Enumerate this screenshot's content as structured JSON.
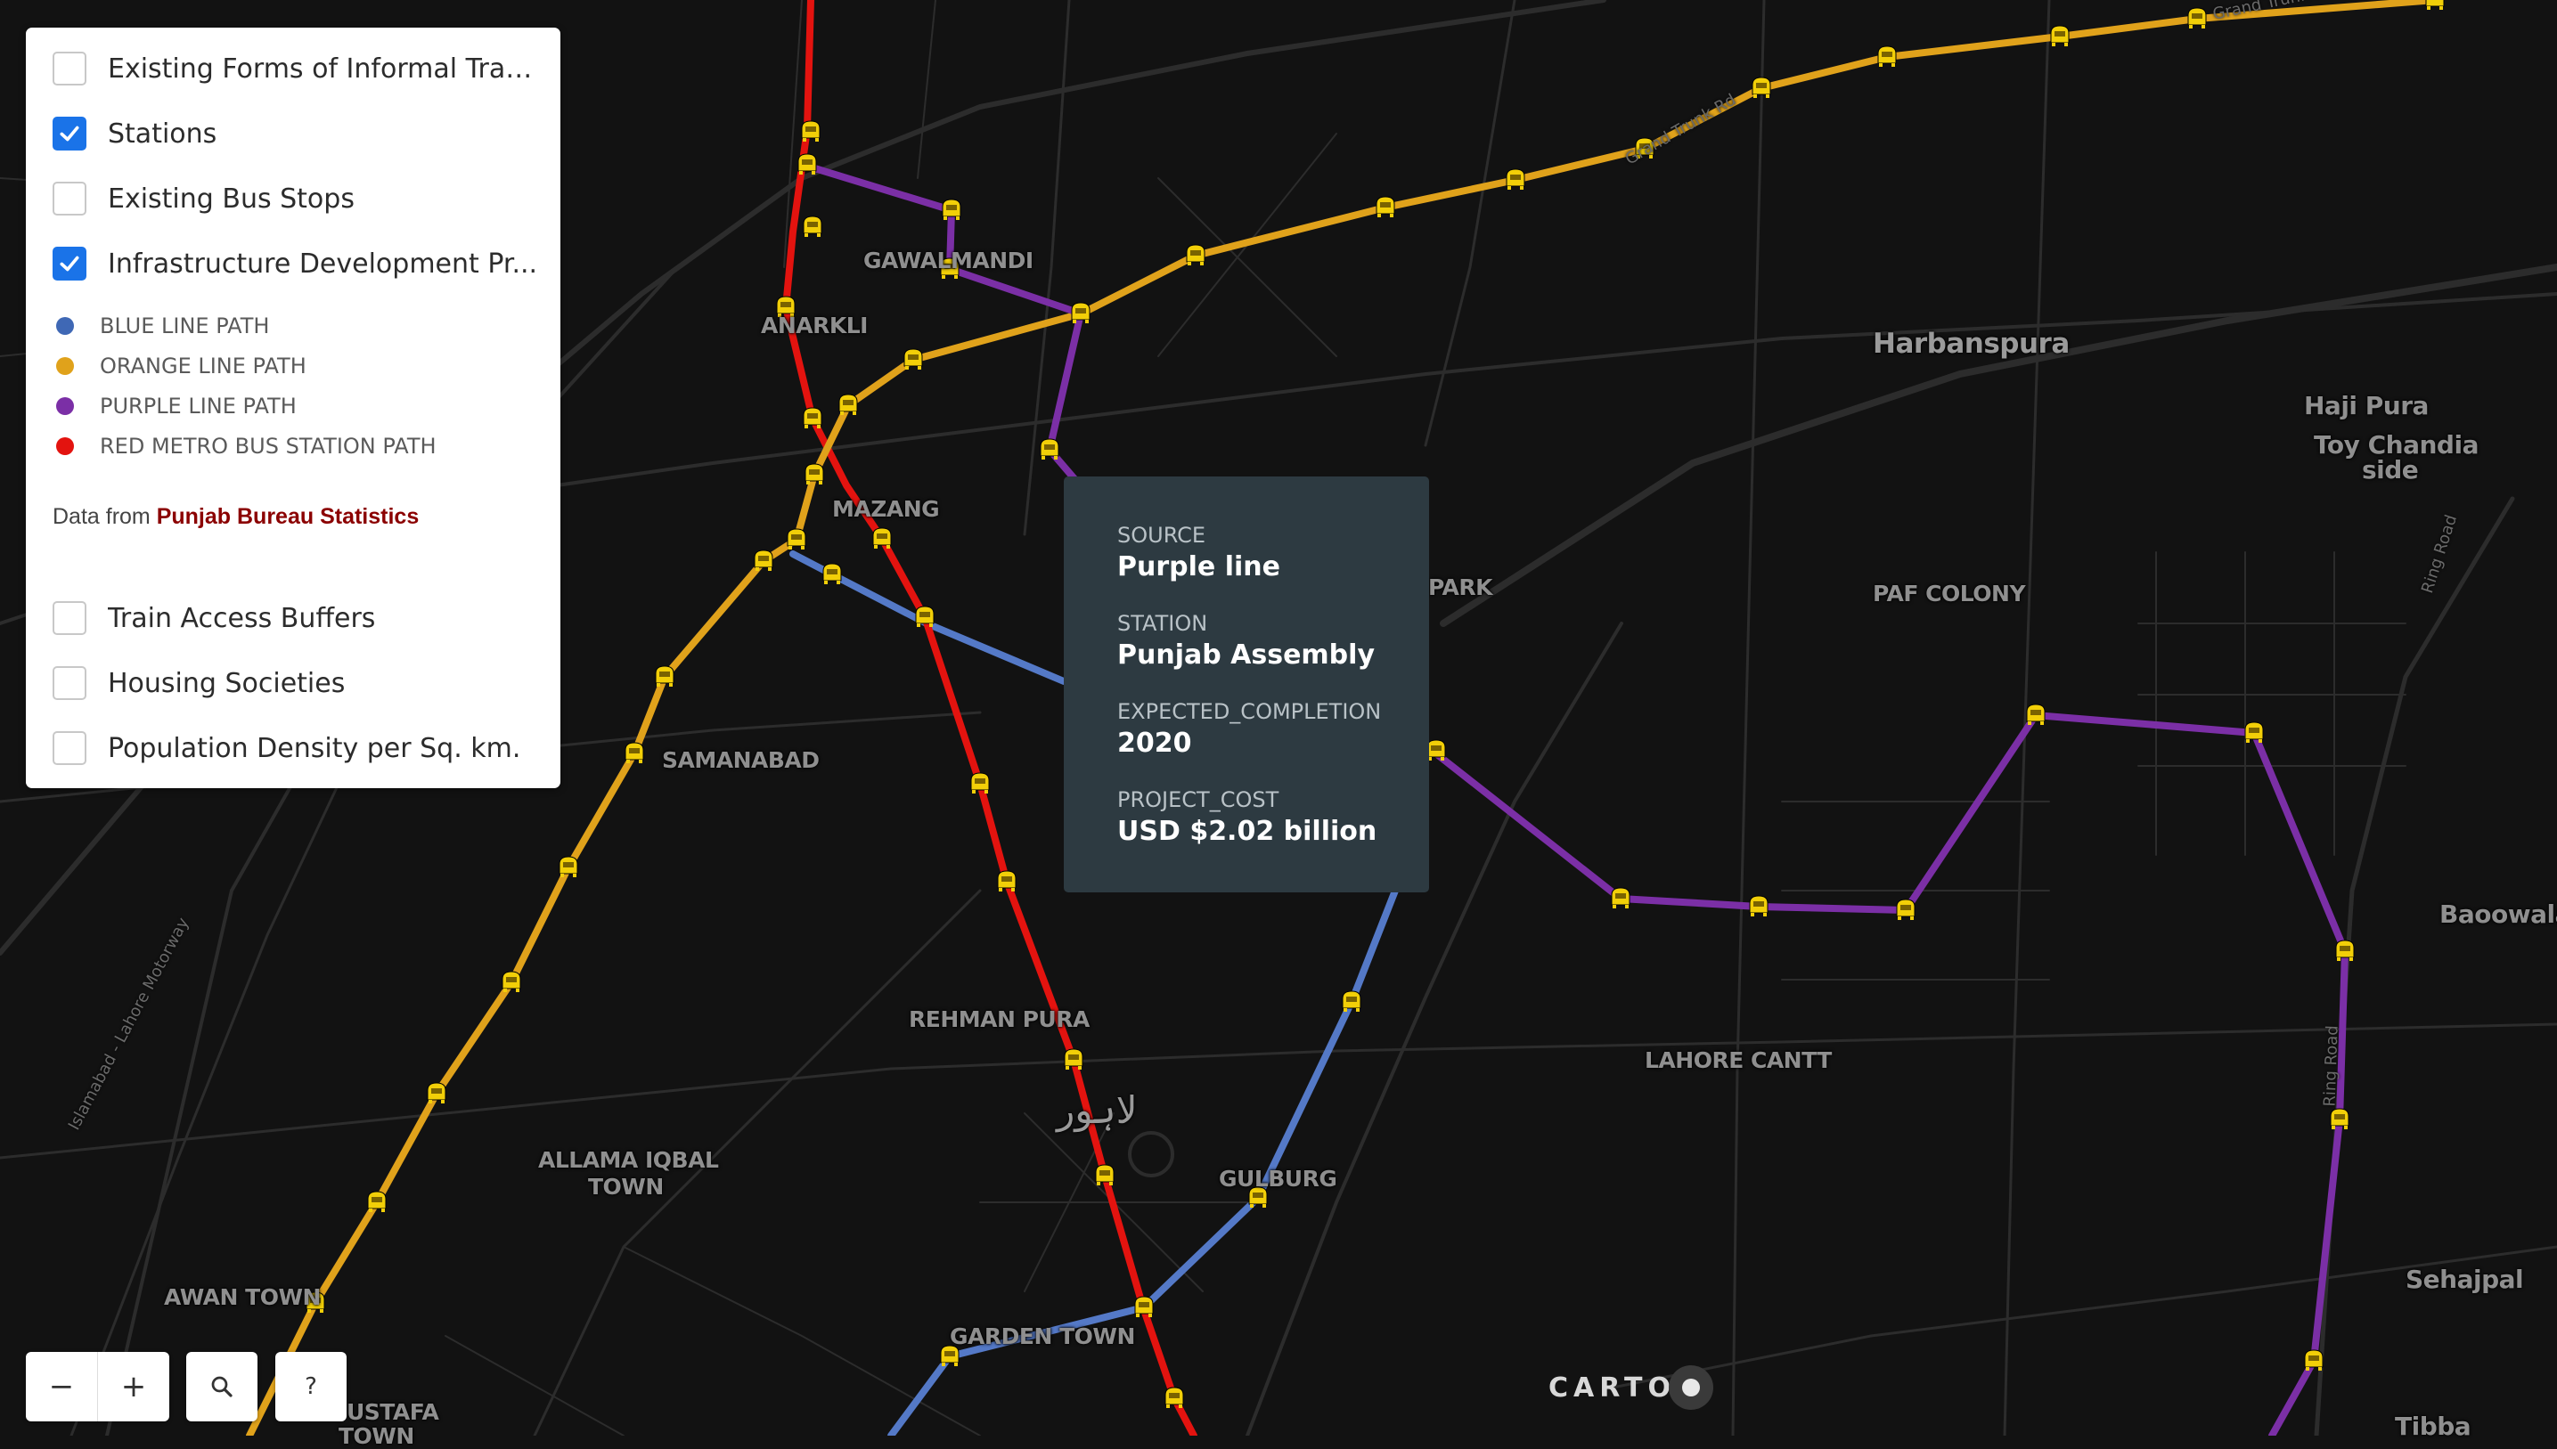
{
  "legend": {
    "layers_top": [
      {
        "label": "Existing Forms of Informal Tran...",
        "checked": false
      },
      {
        "label": "Stations",
        "checked": true
      },
      {
        "label": "Existing Bus Stops",
        "checked": false
      },
      {
        "label": "Infrastructure Development Pr...",
        "checked": true
      }
    ],
    "keys": [
      {
        "label": "BLUE LINE PATH",
        "color": "#3f68b5"
      },
      {
        "label": "ORANGE LINE PATH",
        "color": "#e0a21b"
      },
      {
        "label": "PURPLE LINE PATH",
        "color": "#7b2fa6"
      },
      {
        "label": "RED METRO BUS STATION PATH",
        "color": "#e3130f"
      }
    ],
    "credit_prefix": "Data from",
    "credit_link": "Punjab Bureau Statistics",
    "layers_bottom": [
      {
        "label": "Train Access Buffers",
        "checked": false
      },
      {
        "label": "Housing Societies",
        "checked": false
      },
      {
        "label": "Population Density per Sq. km.",
        "checked": false
      }
    ]
  },
  "tooltip": {
    "fields": [
      {
        "key": "SOURCE",
        "value": "Purple line"
      },
      {
        "key": "STATION",
        "value": "Punjab Assembly"
      },
      {
        "key": "EXPECTED_COMPLETION",
        "value": "2020"
      },
      {
        "key": "PROJECT_COST",
        "value": "USD $2.02 billion"
      }
    ]
  },
  "places": {
    "gawalmandi": "GAWALMANDI",
    "anarkli": "ANARKLI",
    "mazang": "MAZANG",
    "samanabad": "SAMANABAD",
    "rehman_pura": "REHMAN PURA",
    "lahore_urdu": "لاہور",
    "allama_iqbal_1": "ALLAMA IQBAL",
    "allama_iqbal_2": "TOWN",
    "awan_town": "AWAN TOWN",
    "garden_town": "GARDEN TOWN",
    "gulburg": "GULBURG",
    "mustafa": "USTAFA",
    "mustafa_town": "TOWN",
    "park": "PARK",
    "harbanspura": "Harbanspura",
    "haji_pura": "Haji Pura",
    "toy_chandia_1": "Toy Chandia",
    "toy_chandia_2": "side",
    "paf_colony": "PAF COLONY",
    "lahore_cantt": "LAHORE CANTT",
    "baoowala": "Baoowala",
    "sehajpal": "Sehajpal",
    "tibba": "Tibba"
  },
  "roads": {
    "grand_trunk_1": "Grand Trunk Rd",
    "grand_trunk_2": "Grand Trunk Rd",
    "ring_road_1": "Ring Road",
    "ring_road_2": "Ring Road",
    "motorway": "Islamabad - Lahore Motorway"
  },
  "controls": {
    "zoom_out": "−",
    "zoom_in": "+",
    "search": "⌕",
    "help": "?"
  },
  "attribution": "CARTO",
  "colors": {
    "red": "#e3130f",
    "orange": "#e0a21b",
    "purple": "#7b2fa6",
    "blue": "#5479c7",
    "station": "#f5d10a"
  }
}
